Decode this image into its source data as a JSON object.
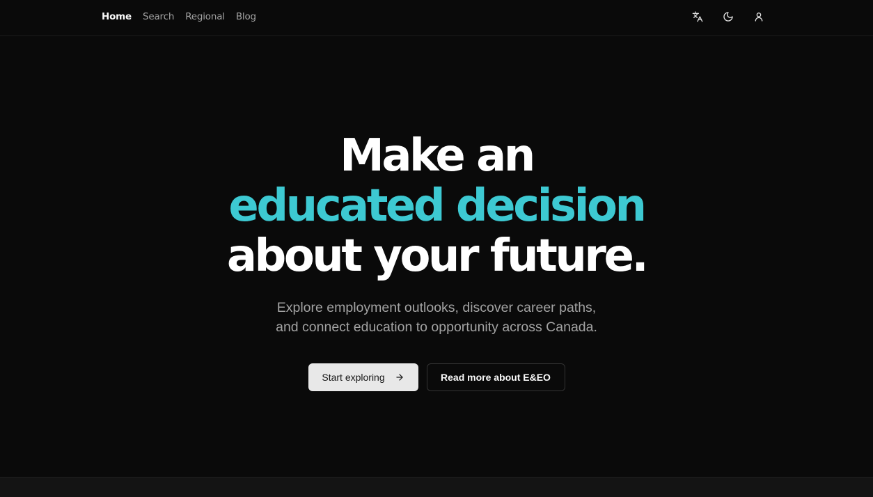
{
  "nav": {
    "items": [
      {
        "label": "Home",
        "active": true
      },
      {
        "label": "Search",
        "active": false
      },
      {
        "label": "Regional",
        "active": false
      },
      {
        "label": "Blog",
        "active": false
      }
    ],
    "icons": [
      "translate-icon",
      "moon-icon",
      "user-icon"
    ]
  },
  "hero": {
    "line1": "Make an",
    "line2": "educated decision",
    "line3": "about your future.",
    "subtitle_line1": "Explore employment outlooks, discover career paths,",
    "subtitle_line2": "and connect education to opportunity across Canada.",
    "primary_button": "Start exploring",
    "secondary_button": "Read more about E&EO"
  },
  "colors": {
    "background": "#0a0a0a",
    "accent": "#3dc9d2",
    "primary_button_bg": "#e8e8e8"
  }
}
